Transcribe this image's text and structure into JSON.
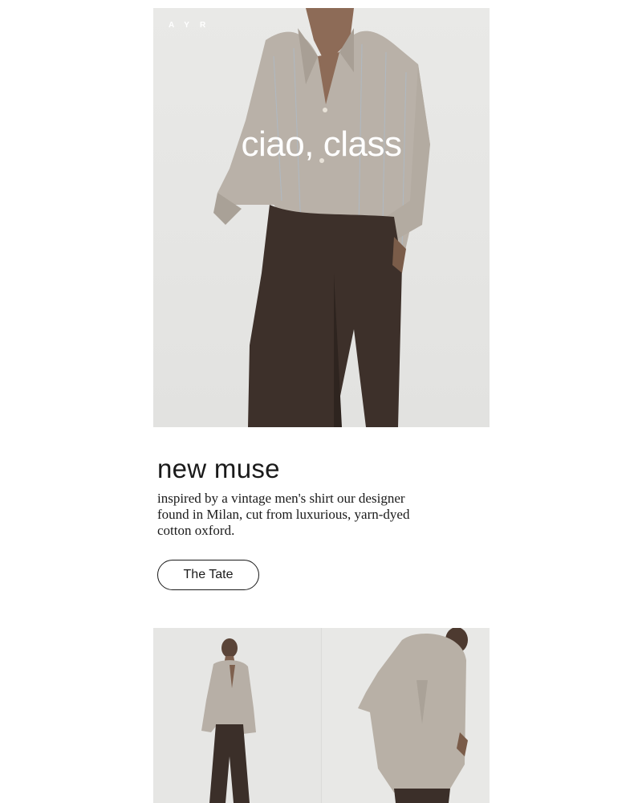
{
  "hero": {
    "brand": "AYR",
    "headline": "ciao, class"
  },
  "feature": {
    "title": "new muse",
    "body": "inspired by a vintage men's shirt our designer found in Milan, cut from luxurious, yarn-dyed cotton oxford.",
    "cta_label": "The Tate"
  },
  "colors": {
    "shirt": "#b7aea4",
    "trousers": "#3b2f29",
    "background": "#e7e7e5",
    "skin": "#8a6a55"
  }
}
